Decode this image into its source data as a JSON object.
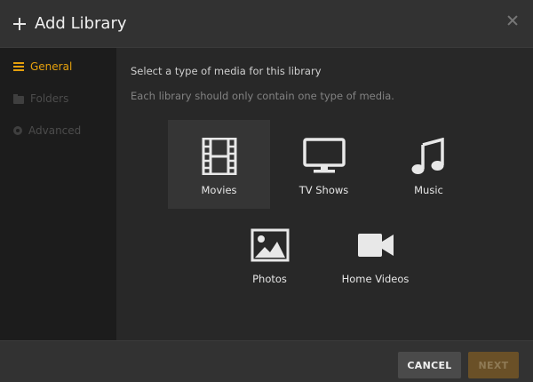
{
  "header": {
    "title": "Add Library"
  },
  "sidebar": {
    "items": [
      {
        "label": "General",
        "icon": "list-icon",
        "active": true
      },
      {
        "label": "Folders",
        "icon": "folder-icon",
        "active": false
      },
      {
        "label": "Advanced",
        "icon": "gear-icon",
        "active": false
      }
    ]
  },
  "main": {
    "prompt": "Select a type of media for this library",
    "subprompt": "Each library should only contain one type of media.",
    "media_types": [
      {
        "label": "Movies",
        "icon": "film-icon",
        "selected": true
      },
      {
        "label": "TV Shows",
        "icon": "tv-icon",
        "selected": false
      },
      {
        "label": "Music",
        "icon": "music-note-icon",
        "selected": false
      },
      {
        "label": "Photos",
        "icon": "photo-icon",
        "selected": false
      },
      {
        "label": "Home Videos",
        "icon": "video-camera-icon",
        "selected": false
      }
    ]
  },
  "footer": {
    "cancel_label": "CANCEL",
    "next_label": "NEXT"
  },
  "colors": {
    "accent": "#e5a00d",
    "background": "#282828",
    "sidebar": "#1c1c1c"
  }
}
